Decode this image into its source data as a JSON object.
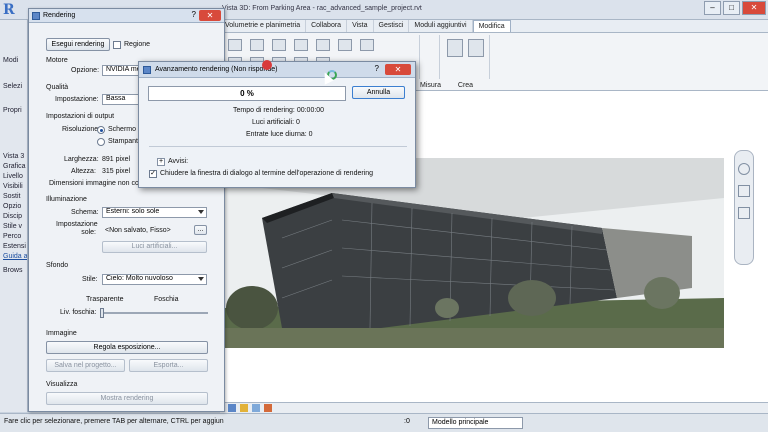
{
  "app": {
    "view_title": "Vista 3D: From Parking Area - rac_advanced_sample_project.rvt",
    "title_partial": "A...",
    "ribbon_tabs": [
      "Volumetrie e planimetria",
      "Collabora",
      "Vista",
      "Gestisci",
      "Moduli aggiuntivi",
      "Modifica"
    ],
    "ribbon_active": "Modifica",
    "ribbon_groups": [
      "Misura",
      "Crea"
    ],
    "left_items": [
      "Modi",
      "Selezi",
      "Propri",
      "Vista 3",
      "Grafica",
      "Livello",
      "Visibili",
      "Sostit",
      "Opzio",
      "Discip",
      "Stile v",
      "Perco",
      "Estensi",
      "Guida a",
      "Brows"
    ],
    "status_text": "Fare clic per selezionare, premere TAB per alternare, CTRL per aggiun",
    "model_select": "Modello principale",
    "status_zero": ":0",
    "win_controls": {
      "min": "–",
      "max": "□",
      "close": "✕"
    }
  },
  "rendering_dialog": {
    "title": "Rendering",
    "help": "?",
    "close": "✕",
    "run_button": "Esegui rendering",
    "region_label": "Regione",
    "engine_section": "Motore",
    "option_label": "Opzione:",
    "option_value": "NVIDIA men",
    "quality_section": "Qualità",
    "setting_label": "Impostazione:",
    "setting_value": "Bassa",
    "output_section": "Impostazioni di output",
    "resolution_label": "Risoluzione:",
    "screen_label": "Schermo",
    "printer_label": "Stampante",
    "width_label": "Larghezza:",
    "width_value": "891 pixel",
    "height_label": "Altezza:",
    "height_value": "315 pixel",
    "dimensions_label": "Dimensioni immagine non compr",
    "lighting_section": "Illuminazione",
    "scheme_label": "Schema:",
    "scheme_value": "Esterni: solo sole",
    "sun_label": "Impostazione sole:",
    "sun_value": "<Non salvato, Fisso>",
    "sun_button": "...",
    "artificial_button": "Luci artificiali...",
    "background_section": "Sfondo",
    "style_label": "Stile:",
    "style_value": "Cielo: Molto nuvoloso",
    "transparent_label": "Trasparente",
    "haze_label": "Foschia",
    "haze_level_label": "Liv. foschia:",
    "haze_level": 0.0,
    "image_section": "Immagine",
    "exposure_button": "Regola esposizione...",
    "save_project_button": "Salva nel progetto...",
    "export_button": "Esporta...",
    "display_section": "Visualizza",
    "show_button": "Mostra rendering"
  },
  "progress_dialog": {
    "title": "Avanzamento rendering (Non risponde)",
    "help": "?",
    "close": "✕",
    "percent_text": "0 %",
    "progress": 0,
    "cancel_button": "Annulla",
    "time_label": "Tempo di rendering: 00:00:00",
    "artificial_lights": "Luci artificiali: 0",
    "daylight_portals": "Entrate luce diurna: 0",
    "warnings_label": "Avvisi:",
    "expander": "+",
    "close_checkbox_label": "Chiudere la finestra di dialogo al termine dell'operazione di rendering",
    "close_checkbox_checked": true
  },
  "colors": {
    "accent": "#3a6fc4",
    "close_red": "#d84a3b",
    "dialog_bg": "#eff2f6",
    "sky": "#ffffff"
  }
}
